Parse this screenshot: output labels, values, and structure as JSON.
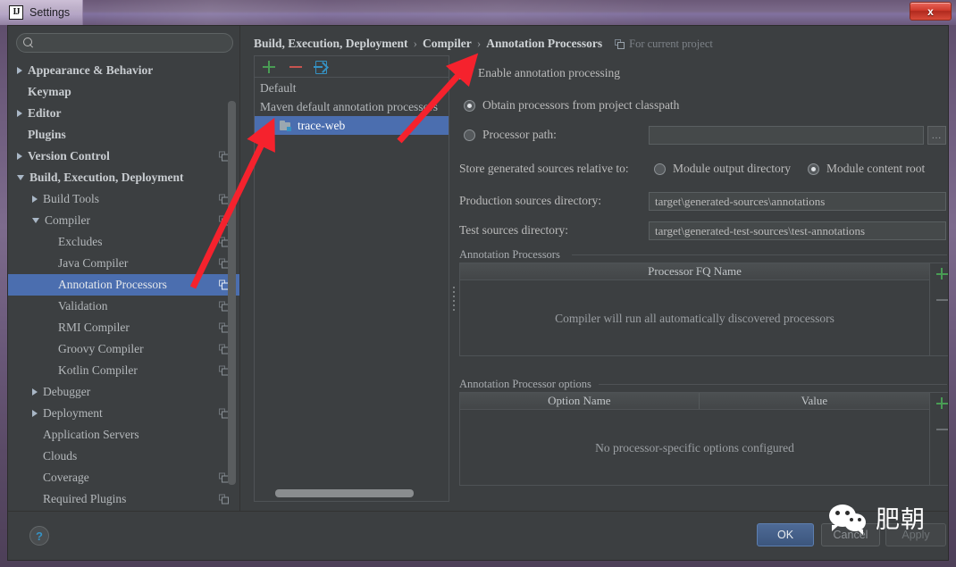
{
  "window": {
    "title": "Settings",
    "logo_text": "IJ",
    "close_label": "x"
  },
  "sidebar": {
    "search_placeholder": "",
    "search_value": "",
    "search_icon": "search-icon",
    "items": [
      {
        "label": "Appearance & Behavior",
        "indent": 0,
        "arrow": "right",
        "bold": true,
        "copy": false,
        "selected": false
      },
      {
        "label": "Keymap",
        "indent": 0,
        "arrow": "none",
        "bold": true,
        "copy": false,
        "selected": false
      },
      {
        "label": "Editor",
        "indent": 0,
        "arrow": "right",
        "bold": true,
        "copy": false,
        "selected": false
      },
      {
        "label": "Plugins",
        "indent": 0,
        "arrow": "none",
        "bold": true,
        "copy": false,
        "selected": false
      },
      {
        "label": "Version Control",
        "indent": 0,
        "arrow": "right",
        "bold": true,
        "copy": true,
        "selected": false
      },
      {
        "label": "Build, Execution, Deployment",
        "indent": 0,
        "arrow": "down",
        "bold": true,
        "copy": false,
        "selected": false
      },
      {
        "label": "Build Tools",
        "indent": 1,
        "arrow": "right",
        "bold": false,
        "copy": true,
        "selected": false
      },
      {
        "label": "Compiler",
        "indent": 1,
        "arrow": "down",
        "bold": false,
        "copy": true,
        "selected": false
      },
      {
        "label": "Excludes",
        "indent": 2,
        "arrow": "none",
        "bold": false,
        "copy": true,
        "selected": false
      },
      {
        "label": "Java Compiler",
        "indent": 2,
        "arrow": "none",
        "bold": false,
        "copy": true,
        "selected": false
      },
      {
        "label": "Annotation Processors",
        "indent": 2,
        "arrow": "none",
        "bold": false,
        "copy": true,
        "selected": true
      },
      {
        "label": "Validation",
        "indent": 2,
        "arrow": "none",
        "bold": false,
        "copy": true,
        "selected": false
      },
      {
        "label": "RMI Compiler",
        "indent": 2,
        "arrow": "none",
        "bold": false,
        "copy": true,
        "selected": false
      },
      {
        "label": "Groovy Compiler",
        "indent": 2,
        "arrow": "none",
        "bold": false,
        "copy": true,
        "selected": false
      },
      {
        "label": "Kotlin Compiler",
        "indent": 2,
        "arrow": "none",
        "bold": false,
        "copy": true,
        "selected": false
      },
      {
        "label": "Debugger",
        "indent": 1,
        "arrow": "right",
        "bold": false,
        "copy": false,
        "selected": false
      },
      {
        "label": "Deployment",
        "indent": 1,
        "arrow": "right",
        "bold": false,
        "copy": true,
        "selected": false
      },
      {
        "label": "Application Servers",
        "indent": 1,
        "arrow": "none",
        "bold": false,
        "copy": false,
        "selected": false
      },
      {
        "label": "Clouds",
        "indent": 1,
        "arrow": "none",
        "bold": false,
        "copy": false,
        "selected": false
      },
      {
        "label": "Coverage",
        "indent": 1,
        "arrow": "none",
        "bold": false,
        "copy": true,
        "selected": false
      },
      {
        "label": "Required Plugins",
        "indent": 1,
        "arrow": "none",
        "bold": false,
        "copy": true,
        "selected": false
      }
    ]
  },
  "breadcrumb": {
    "parts": [
      "Build, Execution, Deployment",
      "Compiler",
      "Annotation Processors"
    ],
    "separator": "›",
    "scope_label": "For current project",
    "scope_icon": "copy-icon"
  },
  "processor_panel": {
    "toolbar": [
      {
        "name": "add-profile-button",
        "icon": "plus-icon"
      },
      {
        "name": "remove-profile-button",
        "icon": "minus-icon"
      },
      {
        "name": "move-to-button",
        "icon": "import-icon"
      }
    ],
    "rows": [
      {
        "label": "Default",
        "child": false,
        "selected": false,
        "icon": null
      },
      {
        "label": "Maven default annotation processors",
        "child": false,
        "selected": false,
        "icon": null
      },
      {
        "label": "trace-web",
        "child": true,
        "selected": true,
        "icon": "module-icon"
      }
    ]
  },
  "options": {
    "enable_annotation_processing": {
      "label": "Enable annotation processing",
      "checked": true
    },
    "obtain_from_classpath": {
      "label": "Obtain processors from project classpath",
      "checked": true
    },
    "processor_path": {
      "label": "Processor path:",
      "checked": false,
      "value": "",
      "browse_label": "…"
    },
    "store_relative_label": "Store generated sources relative to:",
    "store_relative_options": [
      {
        "label": "Module output directory",
        "checked": false
      },
      {
        "label": "Module content root",
        "checked": true
      }
    ],
    "production_sources": {
      "label": "Production sources directory:",
      "value": "target\\generated-sources\\annotations"
    },
    "test_sources": {
      "label": "Test sources directory:",
      "value": "target\\generated-test-sources\\test-annotations"
    }
  },
  "processors_table": {
    "group_title": "Annotation Processors",
    "columns": [
      "Processor FQ Name"
    ],
    "empty_text": "Compiler will run all automatically discovered processors",
    "add_label": "+",
    "remove_label": "−"
  },
  "options_table": {
    "group_title": "Annotation Processor options",
    "columns": [
      "Option Name",
      "Value"
    ],
    "empty_text": "No processor-specific options configured",
    "add_label": "+",
    "remove_label": "−"
  },
  "footer": {
    "help_label": "?",
    "ok_label": "OK",
    "cancel_label": "Cancel",
    "apply_label": "Apply"
  },
  "watermark": {
    "text": "肥朝",
    "icon": "wechat-icon"
  },
  "colors": {
    "selection_blue": "#4b6eaf",
    "accent_green": "#499c54",
    "accent_red": "#c75450",
    "accent_blue": "#3592c4",
    "panel_bg": "#3c3f41",
    "arrow_red": "#f5222d",
    "titlebar_purple": "#7b6a8a"
  }
}
